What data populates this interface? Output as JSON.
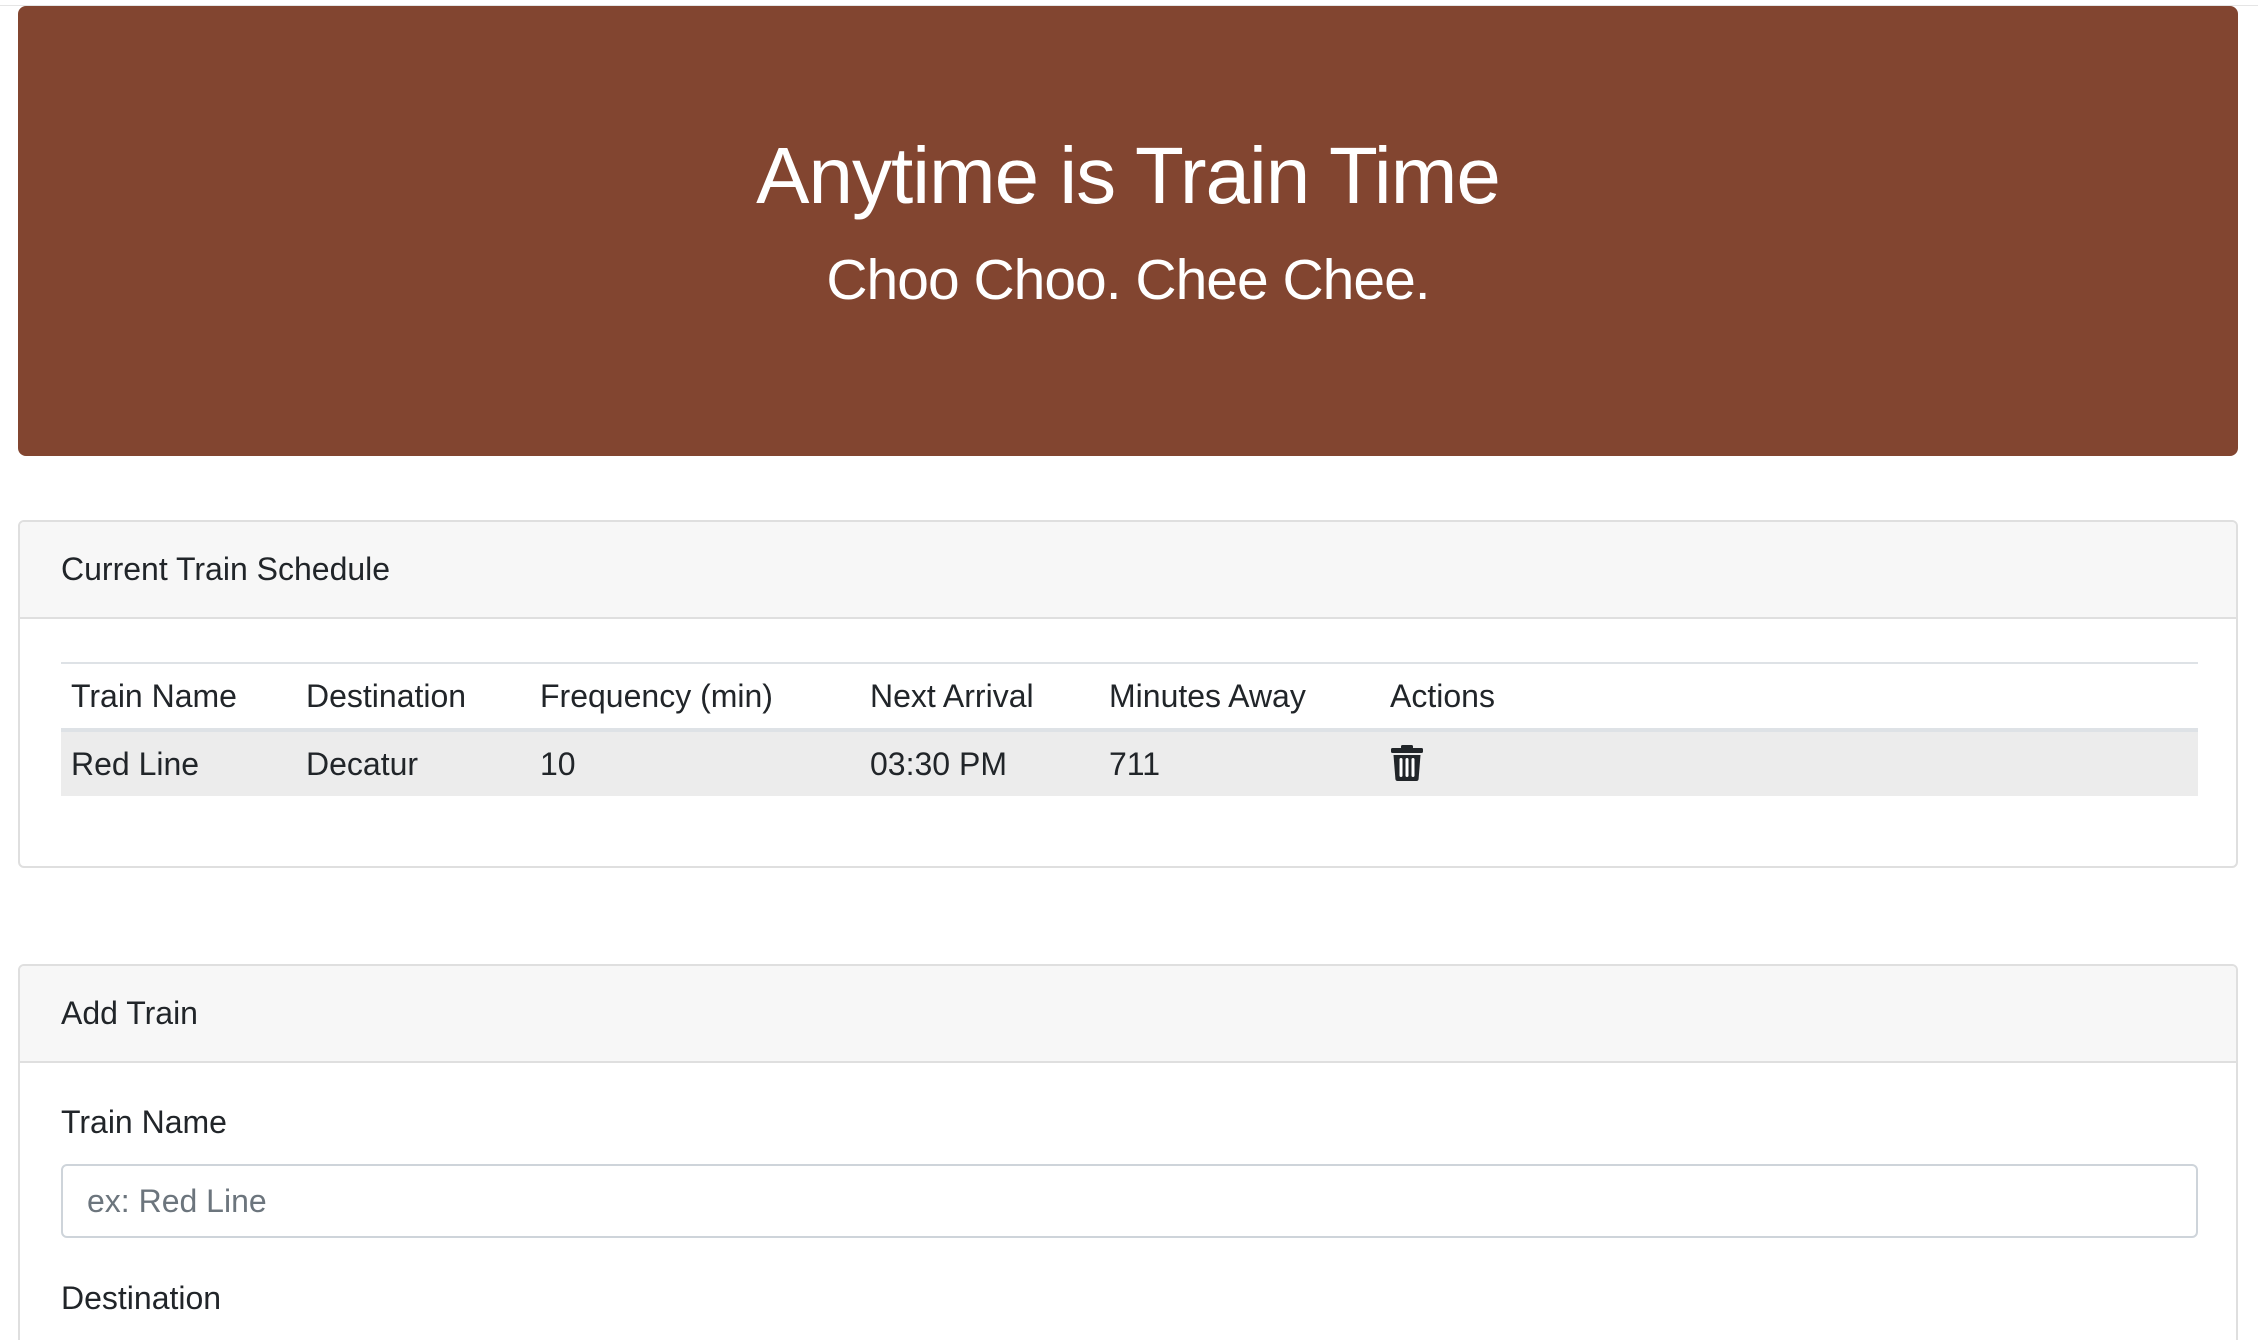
{
  "jumbotron": {
    "title": "Anytime is Train Time",
    "subtitle": "Choo Choo. Chee Chee."
  },
  "schedule": {
    "header": "Current Train Schedule",
    "columns": [
      "Train Name",
      "Destination",
      "Frequency (min)",
      "Next Arrival",
      "Minutes Away",
      "Actions"
    ],
    "rows": [
      {
        "train_name": "Red Line",
        "destination": "Decatur",
        "frequency": "10",
        "next_arrival": "03:30 PM",
        "minutes_away": "711",
        "action_icon": "trash-icon"
      }
    ]
  },
  "add_train": {
    "header": "Add Train",
    "train_name_label": "Train Name",
    "train_name_placeholder": "ex: Red Line",
    "train_name_value": "",
    "destination_label": "Destination"
  },
  "colors": {
    "jumbotron_bg": "#824530",
    "card_header_bg": "#f7f7f7",
    "row_bg": "#ececec"
  }
}
